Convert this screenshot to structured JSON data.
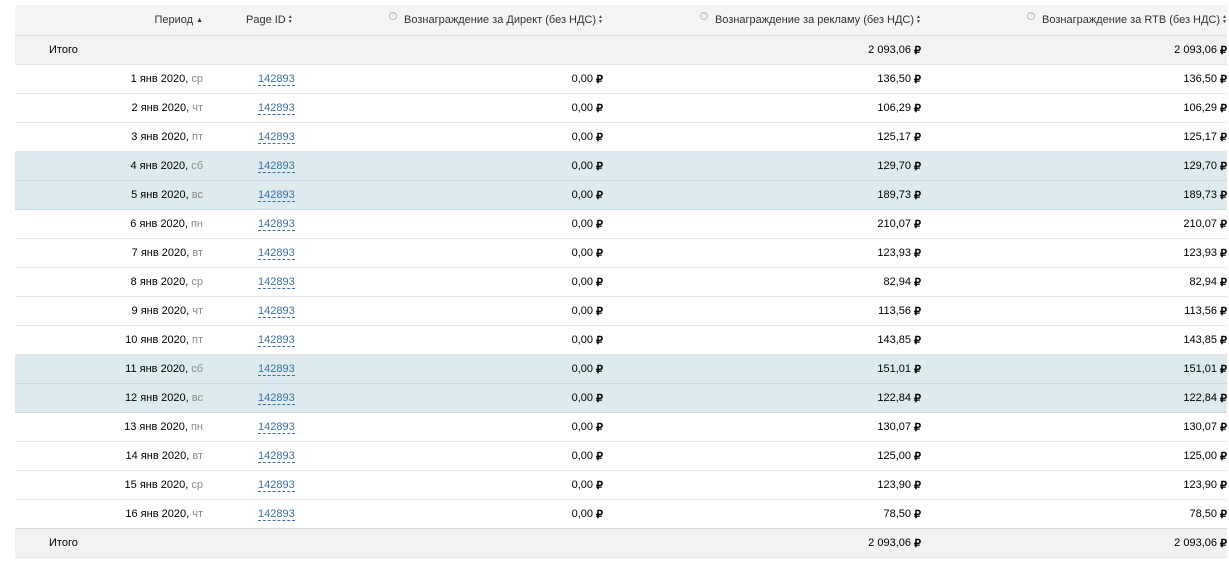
{
  "header": {
    "period": "Период",
    "page_id": "Page ID",
    "direct": "Вознаграждение за Директ (без НДС)",
    "ad": "Вознаграждение за рекламу (без НДС)",
    "rtb": "Вознаграждение за RTB (без НДС)",
    "help_glyph": "?"
  },
  "currency": "₽",
  "total_top": {
    "label": "Итого",
    "direct": "",
    "ad": "2 093,06",
    "rtb": "2 093,06"
  },
  "rows": [
    {
      "date": "1 янв 2020",
      "weekday": "ср",
      "page_id": "142893",
      "direct": "0,00",
      "ad": "136,50",
      "rtb": "136,50",
      "weekend": false
    },
    {
      "date": "2 янв 2020",
      "weekday": "чт",
      "page_id": "142893",
      "direct": "0,00",
      "ad": "106,29",
      "rtb": "106,29",
      "weekend": false
    },
    {
      "date": "3 янв 2020",
      "weekday": "пт",
      "page_id": "142893",
      "direct": "0,00",
      "ad": "125,17",
      "rtb": "125,17",
      "weekend": false
    },
    {
      "date": "4 янв 2020",
      "weekday": "сб",
      "page_id": "142893",
      "direct": "0,00",
      "ad": "129,70",
      "rtb": "129,70",
      "weekend": true
    },
    {
      "date": "5 янв 2020",
      "weekday": "вс",
      "page_id": "142893",
      "direct": "0,00",
      "ad": "189,73",
      "rtb": "189,73",
      "weekend": true
    },
    {
      "date": "6 янв 2020",
      "weekday": "пн",
      "page_id": "142893",
      "direct": "0,00",
      "ad": "210,07",
      "rtb": "210,07",
      "weekend": false
    },
    {
      "date": "7 янв 2020",
      "weekday": "вт",
      "page_id": "142893",
      "direct": "0,00",
      "ad": "123,93",
      "rtb": "123,93",
      "weekend": false
    },
    {
      "date": "8 янв 2020",
      "weekday": "ср",
      "page_id": "142893",
      "direct": "0,00",
      "ad": "82,94",
      "rtb": "82,94",
      "weekend": false
    },
    {
      "date": "9 янв 2020",
      "weekday": "чт",
      "page_id": "142893",
      "direct": "0,00",
      "ad": "113,56",
      "rtb": "113,56",
      "weekend": false
    },
    {
      "date": "10 янв 2020",
      "weekday": "пт",
      "page_id": "142893",
      "direct": "0,00",
      "ad": "143,85",
      "rtb": "143,85",
      "weekend": false
    },
    {
      "date": "11 янв 2020",
      "weekday": "сб",
      "page_id": "142893",
      "direct": "0,00",
      "ad": "151,01",
      "rtb": "151,01",
      "weekend": true
    },
    {
      "date": "12 янв 2020",
      "weekday": "вс",
      "page_id": "142893",
      "direct": "0,00",
      "ad": "122,84",
      "rtb": "122,84",
      "weekend": true
    },
    {
      "date": "13 янв 2020",
      "weekday": "пн",
      "page_id": "142893",
      "direct": "0,00",
      "ad": "130,07",
      "rtb": "130,07",
      "weekend": false
    },
    {
      "date": "14 янв 2020",
      "weekday": "вт",
      "page_id": "142893",
      "direct": "0,00",
      "ad": "125,00",
      "rtb": "125,00",
      "weekend": false
    },
    {
      "date": "15 янв 2020",
      "weekday": "ср",
      "page_id": "142893",
      "direct": "0,00",
      "ad": "123,90",
      "rtb": "123,90",
      "weekend": false
    },
    {
      "date": "16 янв 2020",
      "weekday": "чт",
      "page_id": "142893",
      "direct": "0,00",
      "ad": "78,50",
      "rtb": "78,50",
      "weekend": false
    }
  ],
  "total_bottom": {
    "label": "Итого",
    "direct": "",
    "ad": "2 093,06",
    "rtb": "2 093,06"
  }
}
